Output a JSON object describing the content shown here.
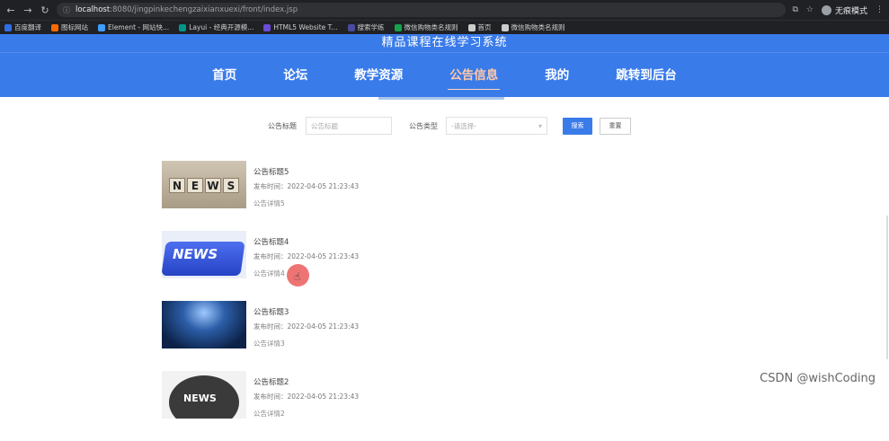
{
  "browser": {
    "url_host": "localhost",
    "url_path": ":8080/jingpinkechengzaixianxuexi/front/index.jsp",
    "profile_label": "无痕模式"
  },
  "bookmarks": [
    {
      "label": "百度翻译",
      "color": "#2f6fe4"
    },
    {
      "label": "图标网站",
      "color": "#ff6a00"
    },
    {
      "label": "Element - 网站快...",
      "color": "#409eff"
    },
    {
      "label": "Layui - 经典开源模...",
      "color": "#009688"
    },
    {
      "label": "HTML5 Website T...",
      "color": "#6a4cd6"
    },
    {
      "label": "搜索学练",
      "color": "#4a4a9e"
    },
    {
      "label": "微信购物类名规则",
      "color": "#16a34a"
    },
    {
      "label": "首页",
      "color": "#cccccc"
    },
    {
      "label": "微信购物类名规则",
      "color": "#cccccc"
    }
  ],
  "site": {
    "title": "精品课程在线学习系统"
  },
  "nav": [
    {
      "label": "首页",
      "active": false
    },
    {
      "label": "论坛",
      "active": false
    },
    {
      "label": "教学资源",
      "active": false
    },
    {
      "label": "公告信息",
      "active": true
    },
    {
      "label": "我的",
      "active": false
    },
    {
      "label": "跳转到后台",
      "active": false
    }
  ],
  "search": {
    "title_label": "公告标题",
    "title_placeholder": "公告标题",
    "type_label": "公告类型",
    "type_placeholder": "-请选择-",
    "search_button": "搜索",
    "reset_button": "重置"
  },
  "notices": [
    {
      "title": "公告标题5",
      "time": "发布时间：2022-04-05 21:23:43",
      "detail": "公告详情5",
      "thumb": "news-blocks"
    },
    {
      "title": "公告标题4",
      "time": "发布时间：2022-04-05 21:23:43",
      "detail": "公告详情4",
      "thumb": "news-key"
    },
    {
      "title": "公告标题3",
      "time": "发布时间：2022-04-05 21:23:43",
      "detail": "公告详情3",
      "thumb": "news-stage"
    },
    {
      "title": "公告标题2",
      "time": "发布时间：2022-04-05 21:23:43",
      "detail": "公告详情2",
      "thumb": "news-globe"
    }
  ],
  "watermark": "CSDN @wishCoding",
  "colors": {
    "brand": "#3a7bea",
    "active_nav": "#ffc9a8",
    "cursor_highlight": "#e84646"
  }
}
